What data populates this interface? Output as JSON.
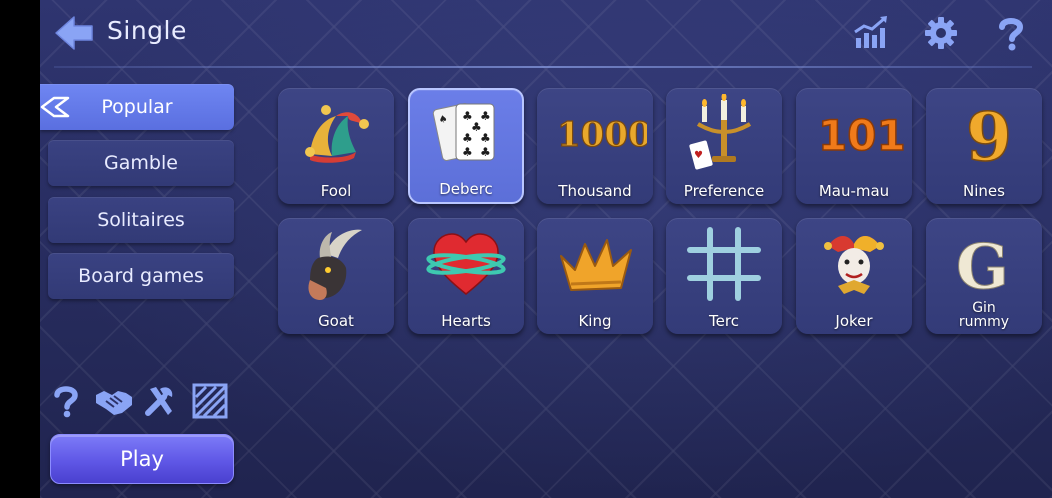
{
  "header": {
    "title": "Single",
    "icons": [
      "back-arrow-icon",
      "statistics-icon",
      "settings-gear-icon",
      "help-icon"
    ]
  },
  "sidebar": {
    "categories": [
      {
        "label": "Popular",
        "active": true
      },
      {
        "label": "Gamble",
        "active": false
      },
      {
        "label": "Solitaires",
        "active": false
      },
      {
        "label": "Board games",
        "active": false
      }
    ],
    "tools": [
      "help-icon",
      "handshake-icon",
      "tools-icon",
      "pattern-icon"
    ],
    "play_label": "Play"
  },
  "games": [
    {
      "label": "Fool",
      "icon": "jester-hat-icon",
      "selected": false
    },
    {
      "label": "Deberc",
      "icon": "playing-cards-icon",
      "selected": true
    },
    {
      "label": "Thousand",
      "icon": "number-1000-icon",
      "selected": false
    },
    {
      "label": "Preference",
      "icon": "candelabra-icon",
      "selected": false
    },
    {
      "label": "Mau-mau",
      "icon": "number-101-icon",
      "selected": false
    },
    {
      "label": "Nines",
      "icon": "number-9-icon",
      "selected": false
    },
    {
      "label": "Goat",
      "icon": "goat-icon",
      "selected": false
    },
    {
      "label": "Hearts",
      "icon": "heart-icon",
      "selected": false
    },
    {
      "label": "King",
      "icon": "crown-icon",
      "selected": false
    },
    {
      "label": "Terc",
      "icon": "hash-grid-icon",
      "selected": false
    },
    {
      "label": "Joker",
      "icon": "joker-icon",
      "selected": false
    },
    {
      "label": "Gin\nrummy",
      "icon": "letter-g-icon",
      "selected": false
    }
  ],
  "art_text": {
    "thousand": "1000",
    "maumau": "101",
    "nines": "9",
    "gin": "G"
  },
  "colors": {
    "accent": "#6f86f2",
    "play": "#5f57e6",
    "tile": "#3a4282",
    "background": "#2a2f63"
  }
}
